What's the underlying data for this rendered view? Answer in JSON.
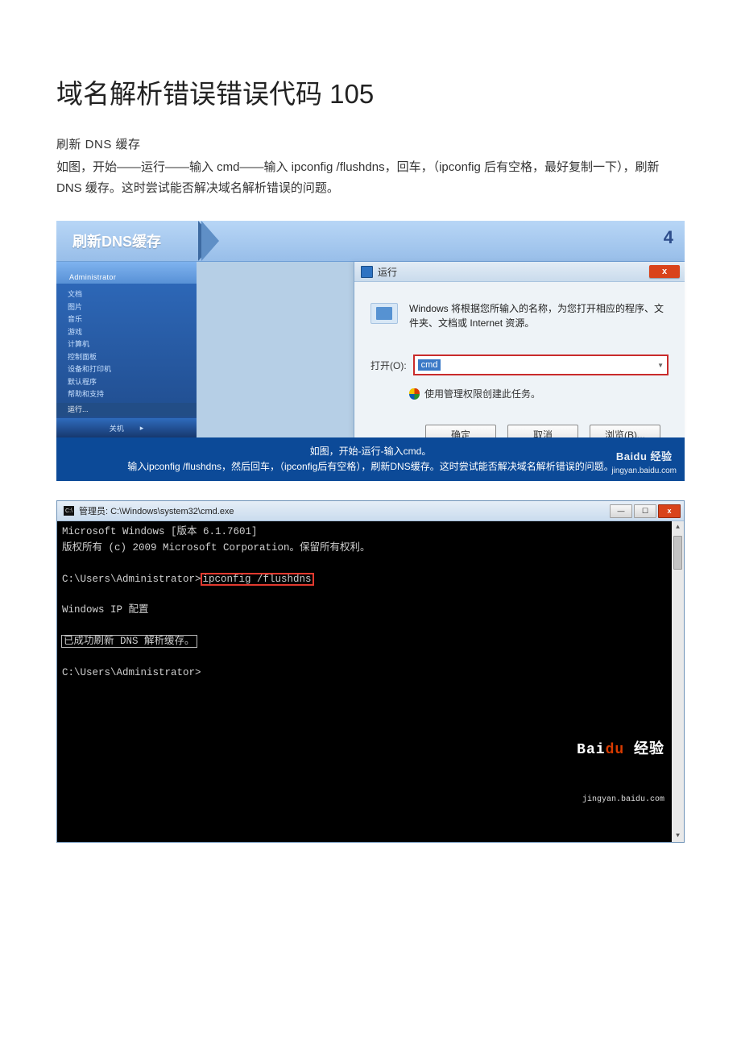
{
  "article": {
    "title": "域名解析错误错误代码 105",
    "subhead": "刷新 DNS 缓存",
    "body": "如图，开始——运行——输入 cmd——输入 ipconfig  /flushdns，回车，（ipconfig 后有空格，最好复制一下），刷新 DNS 缓存。这时尝试能否解决域名解析错误的问题。"
  },
  "step_banner": {
    "title": "刷新DNS缓存",
    "number": "4"
  },
  "startmenu": {
    "user": "Administrator",
    "items": [
      "文档",
      "图片",
      "音乐",
      "游戏",
      "计算机",
      "控制面板",
      "设备和打印机",
      "默认程序",
      "帮助和支持"
    ],
    "run_item": "运行...",
    "footer_left": "关机",
    "footer_right": "▸"
  },
  "run_dialog": {
    "title": "运行",
    "desc": "Windows 将根据您所输入的名称，为您打开相应的程序、文件夹、文档或 Internet 资源。",
    "open_label": "打开(O):",
    "input_value": "cmd",
    "admin_hint": "使用管理权限创建此任务。",
    "buttons": {
      "ok": "确定",
      "cancel": "取消",
      "browse": "浏览(B)..."
    }
  },
  "caption": {
    "line1": "如图，开始-运行-输入cmd。",
    "line2": "输入ipconfig /flushdns，然后回车，（ipconfig后有空格），刷新DNS缓存。这时尝试能否解决域名解析错误的问题。",
    "watermark_logo": "Baidu 经验",
    "watermark_url": "jingyan.baidu.com"
  },
  "cmd_window": {
    "title": "管理员: C:\\Windows\\system32\\cmd.exe",
    "lines": {
      "l1": "Microsoft Windows [版本 6.1.7601]",
      "l2": "版权所有 (c) 2009 Microsoft Corporation。保留所有权利。",
      "prompt1_left": "C:\\Users\\Administrator>",
      "prompt1_cmd": "ipconfig /flushdns",
      "section": "Windows IP 配置",
      "success": "已成功刷新 DNS 解析缓存。",
      "prompt2": "C:\\Users\\Administrator>"
    },
    "watermark_logo_1": "Bai",
    "watermark_logo_2": "du",
    "watermark_logo_3": " 经验",
    "watermark_url": "jingyan.baidu.com"
  }
}
